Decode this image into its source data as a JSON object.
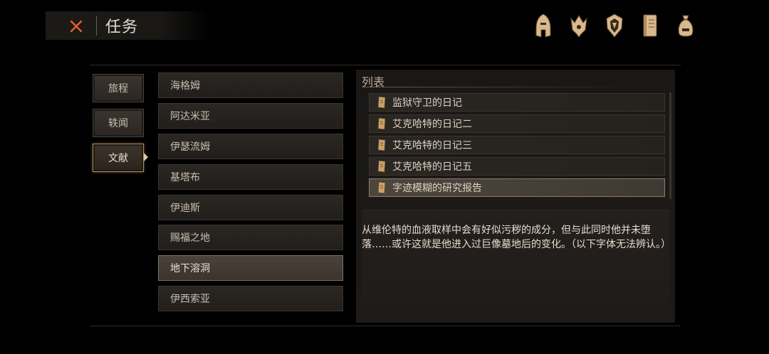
{
  "header": {
    "title": "任务"
  },
  "top_icons": [
    "helmet-icon",
    "crown-emblem-icon",
    "mask-icon",
    "journal-book-icon",
    "bag-icon"
  ],
  "categories": [
    {
      "label": "旅程"
    },
    {
      "label": "轶闻"
    },
    {
      "label": "文献",
      "active": true
    }
  ],
  "locations": [
    {
      "label": "海格姆"
    },
    {
      "label": "阿达米亚"
    },
    {
      "label": "伊瑟流姆"
    },
    {
      "label": "基塔布"
    },
    {
      "label": "伊迪斯"
    },
    {
      "label": "赐福之地"
    },
    {
      "label": "地下溶洞",
      "selected": true
    },
    {
      "label": "伊西索亚"
    }
  ],
  "list": {
    "title": "列表",
    "items": [
      {
        "label": "监狱守卫的日记"
      },
      {
        "label": "艾克哈特的日记二"
      },
      {
        "label": "艾克哈特的日记三"
      },
      {
        "label": "艾克哈特的日记五"
      },
      {
        "label": "字迹模糊的研究报告",
        "selected": true
      }
    ]
  },
  "description": "从维伦特的血液取样中会有好似污秽的成分，但与此同时他并未堕落……或许这就是他进入过巨像墓地后的变化。（以下字体无法辨认。）",
  "colors": {
    "accent": "#b08a55",
    "close_x": "#e2622a"
  }
}
